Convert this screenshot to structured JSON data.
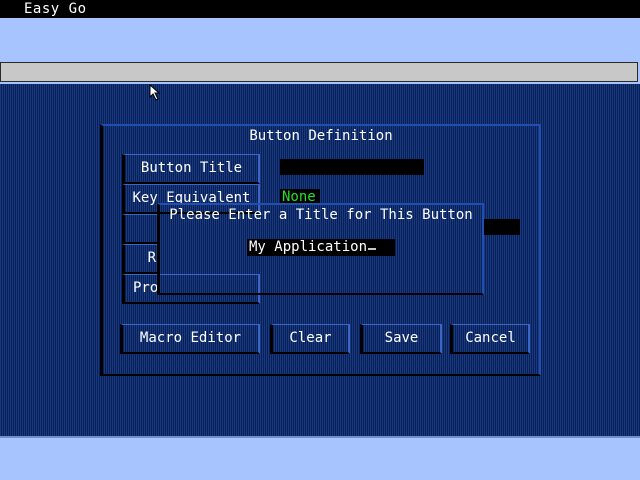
{
  "app": {
    "title": "Easy Go"
  },
  "button_definition": {
    "title": "Button Definition",
    "fields": {
      "button_title_label": "Button Title",
      "key_equivalent_label": "Key Equivalent",
      "key_equivalent_value": "None",
      "row3_label": "",
      "row4_label_visible": "R",
      "program_label_visible": "Pro"
    },
    "actions": {
      "macro_editor": "Macro Editor",
      "clear": "Clear",
      "save": "Save",
      "cancel": "Cancel"
    }
  },
  "title_prompt": {
    "prompt": "Please Enter a Title for This Button",
    "input_value": "My Application"
  },
  "colors": {
    "desktop": "#0e2a66",
    "menu_band": "#a8c4ff",
    "key_value_text": "#25e025"
  },
  "icons": {
    "pointer": "arrow-pointer-icon"
  }
}
